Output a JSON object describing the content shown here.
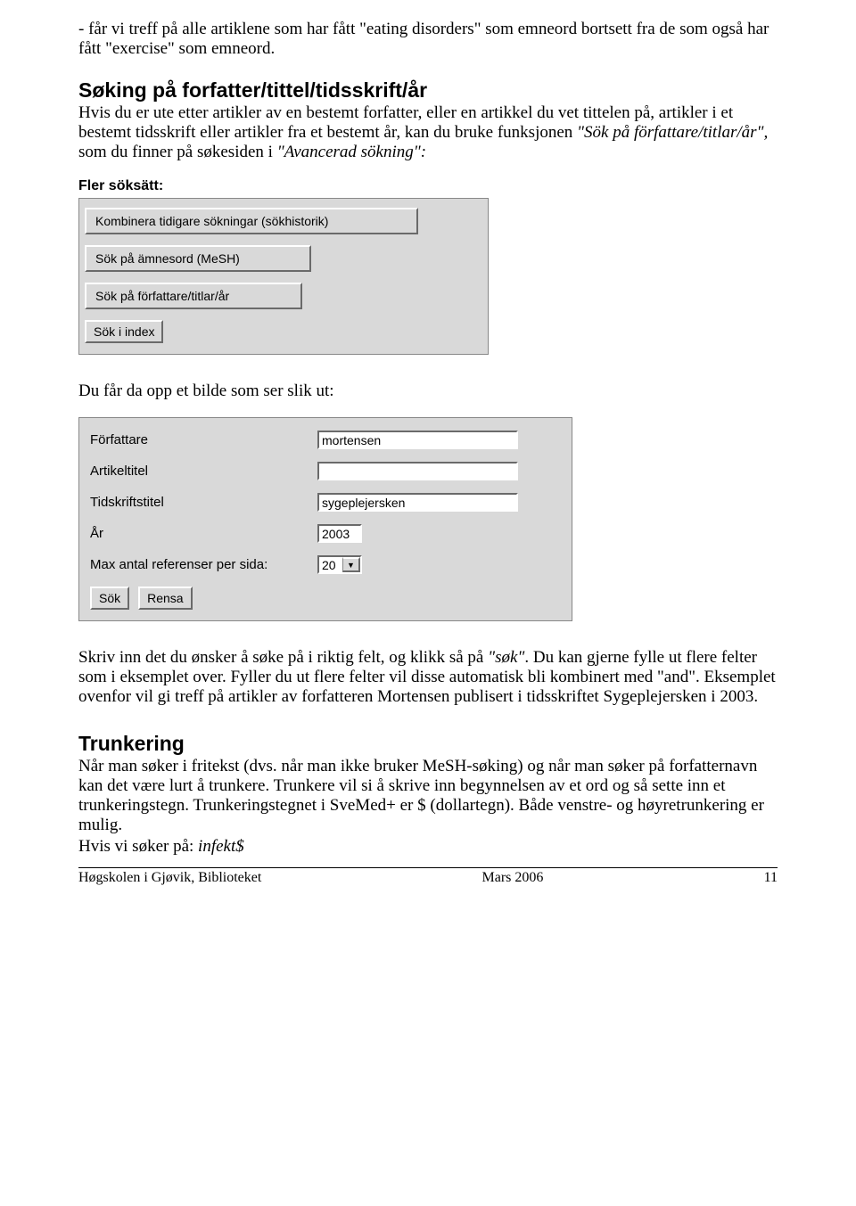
{
  "intro_para": "- får vi treff på alle artiklene som har fått \"eating disorders\" som emneord bortsett fra de som også har fått \"exercise\" som emneord.",
  "section1": {
    "heading": "Søking på forfatter/tittel/tidsskrift/år",
    "para_pre": "Hvis du er ute etter artikler av en bestemt forfatter, eller en artikkel du vet tittelen på, artikler i et bestemt tidsskrift eller artikler fra et bestemt år, kan du bruke funksjonen ",
    "para_em1": "\"Sök på författare/titlar/år\", ",
    "para_mid": "som du finner på søkesiden i ",
    "para_em2": "\"Avancerad sökning\":"
  },
  "panel": {
    "title": "Fler söksätt:",
    "btn1": "Kombinera tidigare sökningar (sökhistorik)",
    "btn2": "Sök på ämnesord (MeSH)",
    "btn3": "Sök på författare/titlar/år",
    "btn4": "Sök i index"
  },
  "mid_para": "Du får da opp et bilde som ser slik ut:",
  "form": {
    "lbl_author": "Författare",
    "lbl_article": "Artikeltitel",
    "lbl_journal": "Tidskriftstitel",
    "lbl_year": "År",
    "lbl_max": "Max antal referenser per sida:",
    "val_author": "mortensen",
    "val_article": "",
    "val_journal": "sygeplejersken",
    "val_year": "2003",
    "val_max": "20",
    "btn_search": "Sök",
    "btn_clear": "Rensa"
  },
  "after_form": {
    "p1_a": "Skriv inn det du ønsker å søke på i riktig felt, og klikk så på ",
    "p1_em": "\"søk\"",
    "p1_b": ". Du kan gjerne fylle ut flere felter som i eksemplet over. Fyller du ut flere felter vil disse automatisk bli kombinert med \"and\". Eksemplet ovenfor vil gi treff på artikler av forfatteren Mortensen publisert i tidsskriftet Sygeplejersken i 2003."
  },
  "section2": {
    "heading": "Trunkering",
    "p1": "Når man søker i fritekst (dvs. når man ikke bruker MeSH-søking) og når man søker på forfatternavn kan det være lurt å trunkere. Trunkere vil si å skrive inn begynnelsen av et ord og så sette inn et trunkeringstegn. Trunkeringstegnet i SveMed+ er $ (dollartegn). Både venstre- og høyretrunkering er mulig.",
    "p2_a": "Hvis vi søker på: ",
    "p2_em": "infekt$"
  },
  "footer": {
    "left": "Høgskolen i Gjøvik, Biblioteket",
    "center": "Mars 2006",
    "right": "11"
  }
}
